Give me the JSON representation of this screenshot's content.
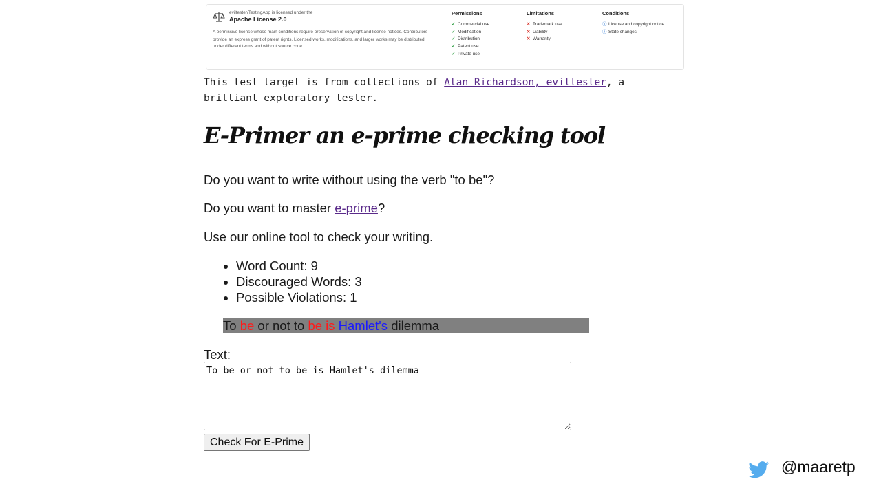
{
  "license": {
    "owner": "eviltester/TestingApp is licensed under the",
    "name": "Apache License 2.0",
    "description": "A permissive license whose main conditions require preservation of copyright and license notices. Contributors provide an express grant of patent rights. Licensed works, modifications, and larger works may be distributed under different terms and without source code.",
    "permissions": {
      "title": "Permissions",
      "items": [
        "Commercial use",
        "Modification",
        "Distribution",
        "Patent use",
        "Private use"
      ]
    },
    "limitations": {
      "title": "Limitations",
      "items": [
        "Trademark use",
        "Liability",
        "Warranty"
      ]
    },
    "conditions": {
      "title": "Conditions",
      "items": [
        "License and copyright notice",
        "State changes"
      ]
    }
  },
  "intro": {
    "before": "This test target is from collections of ",
    "link": "Alan Richardson, eviltester",
    "after": ", a brilliant exploratory tester."
  },
  "heading": "E-Primer an e-prime checking tool",
  "paragraphs": {
    "p1": "Do you want to write without using the verb \"to be\"?",
    "p2_before": "Do you want to master ",
    "p2_link": "e-prime",
    "p2_after": "?",
    "p3": "Use our online tool to check your writing."
  },
  "stats": [
    "Word Count: 9",
    "Discouraged Words: 3",
    "Possible Violations: 1"
  ],
  "result_words": [
    {
      "text": "To",
      "kind": "normal"
    },
    {
      "text": "be",
      "kind": "discouraged"
    },
    {
      "text": "or not to",
      "kind": "normal"
    },
    {
      "text": "be is",
      "kind": "discouraged"
    },
    {
      "text": "Hamlet's",
      "kind": "violation"
    },
    {
      "text": "dilemma",
      "kind": "normal"
    }
  ],
  "form": {
    "label": "Text:",
    "value": "To be or not to be is Hamlet's dilemma",
    "button": "Check For E-Prime"
  },
  "footer": {
    "handle": "@maaretp"
  },
  "colors": {
    "discouraged": "#ff1a1a",
    "violation": "#1a1aff",
    "result_background": "#808080",
    "link": "#5a2a8a",
    "twitter_blue": "#55acee"
  },
  "icons": [
    "scale-icon",
    "check-icon",
    "cross-icon",
    "info-icon",
    "twitter-icon"
  ]
}
